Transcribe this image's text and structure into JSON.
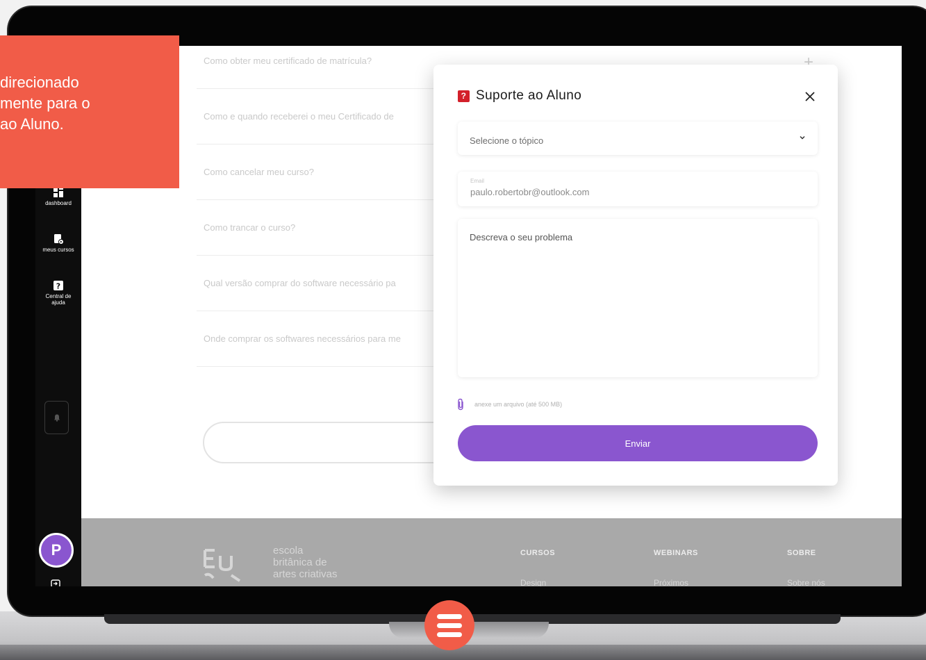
{
  "callout": {
    "line1": "direcionado",
    "line2": "mente para o",
    "line3": "ao Aluno."
  },
  "sidebar": {
    "items": [
      {
        "label": "dashboard",
        "icon": "dashboard-icon"
      },
      {
        "label": "meus cursos",
        "icon": "courses-icon"
      },
      {
        "label": "Central de ajuda",
        "icon": "help-icon"
      }
    ],
    "bell_icon": "bell-icon",
    "avatar_initial": "P",
    "logout_icon": "logout-icon"
  },
  "faq": {
    "items": [
      "Como obter meu certificado de matrícula?",
      "Como e quando receberei o meu Certificado de",
      "Como cancelar meu curso?",
      "Como trancar o curso?",
      "Qual versão comprar do software necessário pa",
      "Onde comprar os softwares necessários para me"
    ],
    "plus": "+"
  },
  "footer": {
    "brand_line1": "escola",
    "brand_line2": "britânica de",
    "brand_line3": "artes criativas",
    "columns": [
      {
        "title": "CURSOS",
        "link": "Design"
      },
      {
        "title": "WEBINARS",
        "link": "Próximos"
      },
      {
        "title": "SOBRE",
        "link": "Sobre nós"
      }
    ]
  },
  "modal": {
    "badge": "?",
    "title": "Suporte ao Aluno",
    "close_icon": "close-icon",
    "topic_placeholder": "Selecione o tópico",
    "email_label": "Email",
    "email_value": "paulo.robertobr@outlook.com",
    "description_placeholder": "Descreva o seu problema",
    "attach_text": "anexe um arquivo (até 500 MB)",
    "send_label": "Enviar"
  },
  "colors": {
    "accent": "#8a56cf",
    "callout": "#f15c48",
    "badge_red": "#d3202a",
    "sidebar": "#0d0d0d"
  }
}
